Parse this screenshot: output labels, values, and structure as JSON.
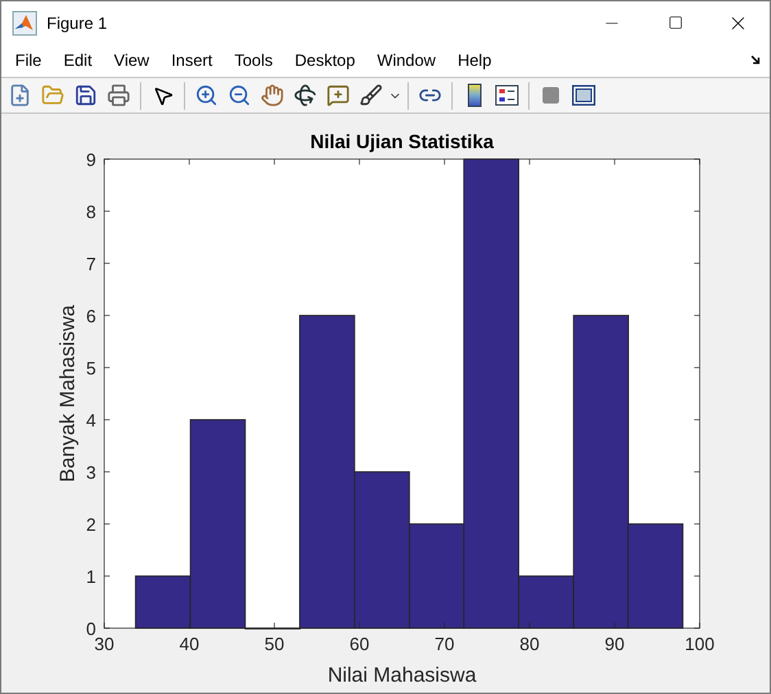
{
  "window": {
    "title": "Figure 1"
  },
  "menu": [
    "File",
    "Edit",
    "View",
    "Insert",
    "Tools",
    "Desktop",
    "Window",
    "Help"
  ],
  "figure": {
    "chart_data": {
      "type": "bar",
      "title": "Nilai Ujian Statistika",
      "xlabel": "Nilai Mahasiswa",
      "ylabel": "Banyak Mahasiswa",
      "x": [
        36.9,
        43.35,
        49.8,
        56.2,
        62.65,
        69.1,
        75.5,
        81.95,
        88.4,
        94.8
      ],
      "series": [
        {
          "color": "#352a87",
          "values": [
            1,
            4,
            0,
            6,
            3,
            2,
            9,
            1,
            6,
            2
          ]
        }
      ],
      "xlim": [
        30,
        100
      ],
      "ylim": [
        0,
        9
      ],
      "xticks": [
        30,
        40,
        50,
        60,
        70,
        80,
        90,
        100
      ],
      "yticks": [
        0,
        1,
        2,
        3,
        4,
        5,
        6,
        7,
        8,
        9
      ]
    }
  }
}
